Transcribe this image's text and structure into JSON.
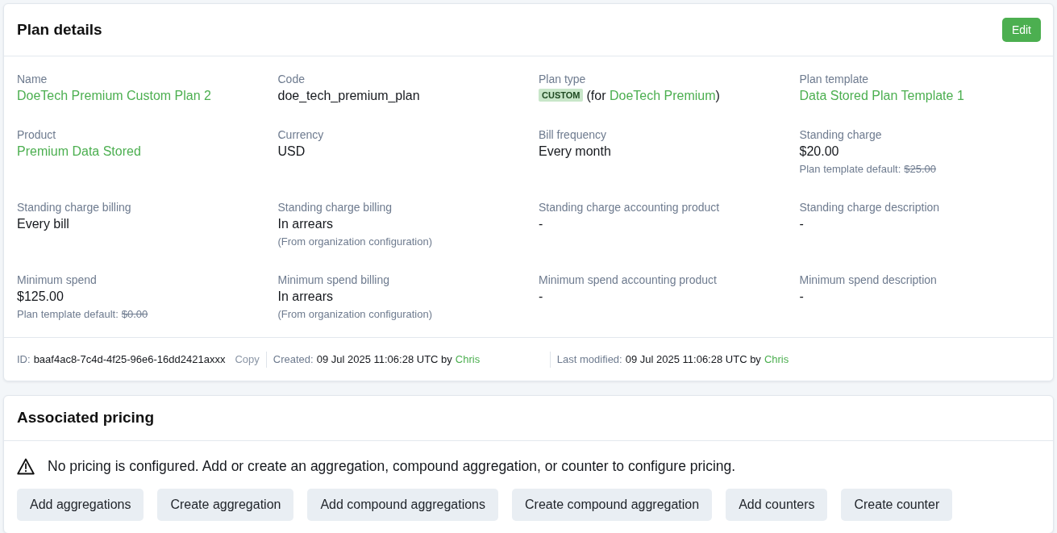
{
  "plan_details": {
    "title": "Plan details",
    "edit_button": "Edit",
    "fields": [
      {
        "kind": "link",
        "label": "Name",
        "value": "DoeTech Premium Custom Plan 2"
      },
      {
        "kind": "text",
        "label": "Code",
        "value": "doe_tech_premium_plan"
      },
      {
        "kind": "plan_type",
        "label": "Plan type",
        "badge": "CUSTOM",
        "value_before": "(for",
        "link": "DoeTech Premium",
        "value_after": ")"
      },
      {
        "kind": "link",
        "label": "Plan template",
        "value": "Data Stored Plan Template 1"
      },
      {
        "kind": "link",
        "label": "Product",
        "value": "Premium Data Stored"
      },
      {
        "kind": "text",
        "label": "Currency",
        "value": "USD"
      },
      {
        "kind": "text",
        "label": "Bill frequency",
        "value": "Every month"
      },
      {
        "kind": "text",
        "label": "Standing charge",
        "value": "$20.00",
        "default_label": "Plan template default:",
        "default_value": "$25.00"
      },
      {
        "kind": "text",
        "label": "Standing charge billing",
        "value": "Every bill"
      },
      {
        "kind": "text",
        "label": "Standing charge billing",
        "value": "In arrears",
        "note": "(From organization configuration)"
      },
      {
        "kind": "text",
        "label": "Standing charge accounting product",
        "value": "-"
      },
      {
        "kind": "text",
        "label": "Standing charge description",
        "value": "-"
      },
      {
        "kind": "text",
        "label": "Minimum spend",
        "value": "$125.00",
        "default_label": "Plan template default:",
        "default_value": "$0.00"
      },
      {
        "kind": "text",
        "label": "Minimum spend billing",
        "value": "In arrears",
        "note": "(From organization configuration)"
      },
      {
        "kind": "text",
        "label": "Minimum spend accounting product",
        "value": "-"
      },
      {
        "kind": "text",
        "label": "Minimum spend description",
        "value": "-"
      }
    ],
    "footer": {
      "id_label": "ID:",
      "id": "baaf4ac8-7c4d-4f25-96e6-16dd2421axxx",
      "copy": "Copy",
      "created_label": "Created:",
      "created": "09 Jul 2025 11:06:28 UTC by",
      "created_by": "Chris",
      "modified_label": "Last modified:",
      "modified": "09 Jul 2025 11:06:28 UTC by",
      "modified_by": "Chris"
    }
  },
  "associated_pricing": {
    "title": "Associated pricing",
    "warning": "No pricing is configured. Add or create an aggregation, compound aggregation, or counter to configure pricing.",
    "buttons": [
      "Add aggregations",
      "Create aggregation",
      "Add compound aggregations",
      "Create compound aggregation",
      "Add counters",
      "Create counter"
    ]
  }
}
